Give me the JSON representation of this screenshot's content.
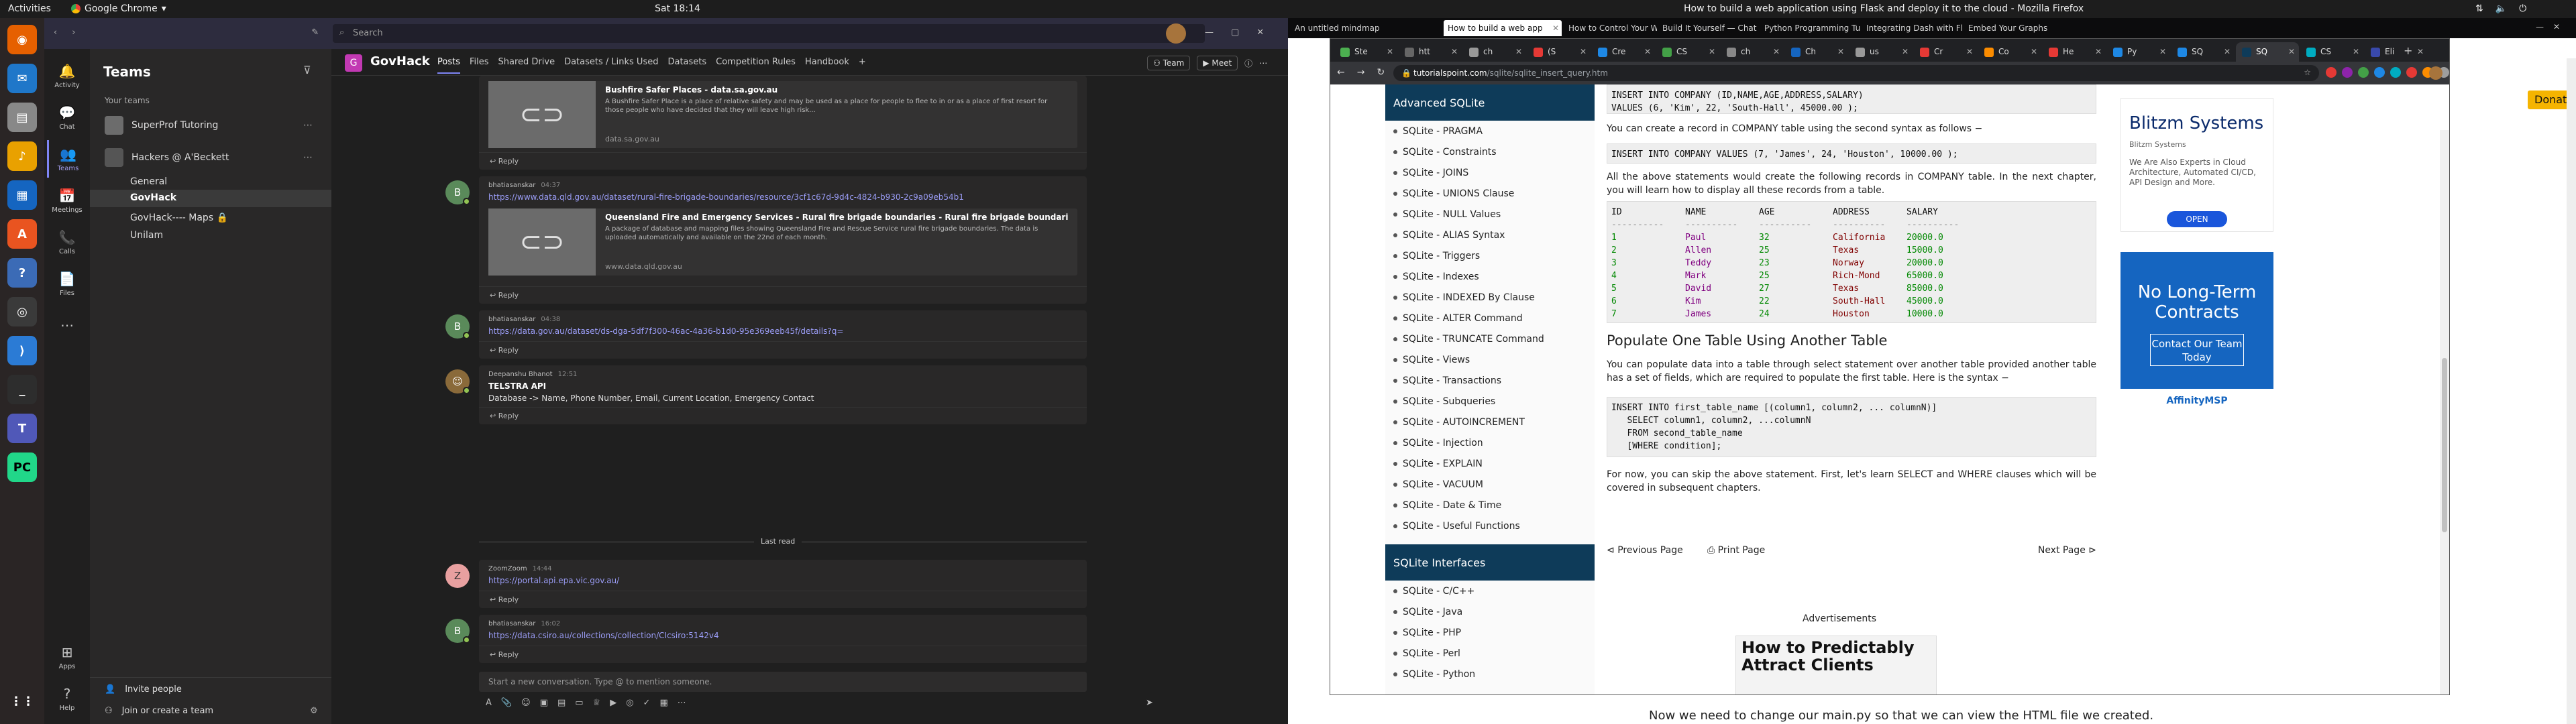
{
  "topbar": {
    "activities": "Activities",
    "app": "Google Chrome",
    "clock": "Sat 18:14",
    "window_title": "How to build a web application using Flask and deploy it to the cloud - Mozilla Firefox"
  },
  "teams": {
    "search_placeholder": "Search",
    "rail": [
      {
        "label": "Activity",
        "icon": "bell-icon"
      },
      {
        "label": "Chat",
        "icon": "chat-icon"
      },
      {
        "label": "Teams",
        "icon": "teams-icon"
      },
      {
        "label": "Meetings",
        "icon": "calendar-icon"
      },
      {
        "label": "Calls",
        "icon": "phone-icon"
      },
      {
        "label": "Files",
        "icon": "file-icon"
      }
    ],
    "rail_bottom": [
      {
        "label": "Apps"
      },
      {
        "label": "Help"
      }
    ],
    "sidebar": {
      "title": "Teams",
      "your_teams": "Your teams",
      "teams": [
        {
          "name": "SuperProf Tutoring",
          "color": "#6c6c6c"
        },
        {
          "name": "Hackers @ A'Beckett",
          "color": "#555555"
        }
      ],
      "channels": [
        "General",
        "GovHack",
        "GovHack---- Maps",
        "Unilam"
      ],
      "invite": "Invite people",
      "join": "Join or create a team"
    },
    "channel": {
      "logo": "G",
      "name": "GovHack",
      "tabs": [
        "Posts",
        "Files",
        "Shared Drive",
        "Datasets / Links Used",
        "Datasets",
        "Competition Rules",
        "Handbook"
      ],
      "team_btn": "Team",
      "meet_btn": "Meet",
      "messages": [
        {
          "preview_title": "Bushfire Safer Places - data.sa.gov.au",
          "preview_desc": "A Bushfire Safer Place is a place of relative safety and may be used as a place for people to flee to in or as a place of first resort for those people who have decided that they will leave high risk...",
          "preview_url": "data.sa.gov.au",
          "reply": "Reply"
        },
        {
          "avatar": "B",
          "author": "bhatiasanskar",
          "time": "04:37",
          "link": "https://www.data.qld.gov.au/dataset/rural-fire-brigade-boundaries/resource/3cf1c67d-9d4c-4824-b930-2c9a09eb54b1",
          "preview_title": "Queensland Fire and Emergency Services - Rural fire brigade boundaries - Rural fire brigade boundaries - Open...",
          "preview_desc": "A package of database and mapping files showing Queensland Fire and Rescue Service rural fire brigade boundaries. The data is uploaded automatically and available on the 22nd of each month.",
          "preview_url": "www.data.qld.gov.au",
          "reply": "Reply"
        },
        {
          "avatar": "B",
          "author": "bhatiasanskar",
          "time": "04:38",
          "link": "https://data.gov.au/dataset/ds-dga-5df7f300-46ac-4a36-b1d0-95e369eeb45f/details?q=",
          "reply": "Reply"
        },
        {
          "author": "Deepanshu Bhanot",
          "time": "12:51",
          "title": "TELSTRA API",
          "text": "Database -> Name, Phone Number, Email, Current Location, Emergency Contact",
          "reply": "Reply"
        },
        {
          "avatar": "Z",
          "author": "ZoomZoom",
          "time": "14:44",
          "link": "https://portal.api.epa.vic.gov.au/",
          "reply": "Reply"
        },
        {
          "avatar": "B",
          "author": "bhatiasanskar",
          "time": "16:02",
          "link": "https://data.csiro.au/collections/collection/CIcsiro:5142v4",
          "reply": "Reply"
        }
      ],
      "last_read": "Last read",
      "compose_placeholder": "Start a new conversation. Type @ to mention someone."
    }
  },
  "firefox": {
    "tabs": [
      "An untitled mindmap",
      "How to build a web app",
      "How to Control Your W",
      "Build It Yourself — Chat",
      "Python Programming Tu",
      "Integrating Dash with Fla",
      "Embed Your Graphs"
    ],
    "bg_text": "Now we need to change our main.py so that we can view the HTML file we created.",
    "donate": "Donate"
  },
  "chrome": {
    "tabs": [
      "Ste",
      "htt",
      "ch",
      "(S",
      "Cre",
      "CS",
      "ch",
      "Ch",
      "us",
      "Cr",
      "Co",
      "He",
      "Py",
      "SQ",
      "SQ",
      "CS",
      "Eli"
    ],
    "url_host": "tutorialspoint.com",
    "url_path": "/sqlite/sqlite_insert_query.htm",
    "nav": {
      "head1": "Advanced SQLite",
      "items1": [
        "SQLite - PRAGMA",
        "SQLite - Constraints",
        "SQLite - JOINS",
        "SQLite - UNIONS Clause",
        "SQLite - NULL Values",
        "SQLite - ALIAS Syntax",
        "SQLite - Triggers",
        "SQLite - Indexes",
        "SQLite - INDEXED By Clause",
        "SQLite - ALTER Command",
        "SQLite - TRUNCATE Command",
        "SQLite - Views",
        "SQLite - Transactions",
        "SQLite - Subqueries",
        "SQLite - AUTOINCREMENT",
        "SQLite - Injection",
        "SQLite - EXPLAIN",
        "SQLite - VACUUM",
        "SQLite - Date & Time",
        "SQLite - Useful Functions"
      ],
      "head2": "SQLite Interfaces",
      "items2": [
        "SQLite - C/C++",
        "SQLite - Java",
        "SQLite - PHP",
        "SQLite - Perl",
        "SQLite - Python"
      ]
    },
    "main": {
      "code1": "INSERT INTO COMPANY (ID,NAME,AGE,ADDRESS,SALARY)\nVALUES (6, 'Kim', 22, 'South-Hall', 45000.00 );",
      "p1": "You can create a record in COMPANY table using the second syntax as follows −",
      "code2": "INSERT INTO COMPANY VALUES (7, 'James', 24, 'Houston', 10000.00 );",
      "p2": "All the above statements would create the following records in COMPANY table. In the next chapter, you will learn how to display all these records from a table.",
      "table_header": [
        "ID",
        "NAME",
        "AGE",
        "ADDRESS",
        "SALARY"
      ],
      "table_dash": [
        "----------",
        "----------",
        "----------",
        "----------",
        "----------"
      ],
      "table_rows": [
        [
          "1",
          "Paul",
          "32",
          "California",
          "20000.0"
        ],
        [
          "2",
          "Allen",
          "25",
          "Texas",
          "15000.0"
        ],
        [
          "3",
          "Teddy",
          "23",
          "Norway",
          "20000.0"
        ],
        [
          "4",
          "Mark",
          "25",
          "Rich-Mond",
          "65000.0"
        ],
        [
          "5",
          "David",
          "27",
          "Texas",
          "85000.0"
        ],
        [
          "6",
          "Kim",
          "22",
          "South-Hall",
          "45000.0"
        ],
        [
          "7",
          "James",
          "24",
          "Houston",
          "10000.0"
        ]
      ],
      "h2": "Populate One Table Using Another Table",
      "p3": "You can populate data into a table through select statement over another table provided another table has a set of fields, which are required to populate the first table. Here is the syntax −",
      "code3": "INSERT INTO first_table_name [(column1, column2, ... columnN)]\n   SELECT column1, column2, ...columnN\n   FROM second_table_name\n   [WHERE condition];",
      "p4": "For now, you can skip the above statement. First, let's learn SELECT and WHERE clauses which will be covered in subsequent chapters.",
      "prev": "Previous Page",
      "print": "Print Page",
      "next": "Next Page",
      "ads_label": "Advertisements",
      "ad3": "How to Predictably Attract Clients"
    },
    "ad1": {
      "title": "Blitzm Systems",
      "sub": "Blitzm Systems",
      "desc": "We Are Also Experts in Cloud Architecture, Automated CI/CD, API Design and More.",
      "btn": "OPEN"
    },
    "ad2": {
      "title": "No Long-Term Contracts",
      "btn": "Contact Our Team Today",
      "logo": "AffinityMSP"
    }
  }
}
